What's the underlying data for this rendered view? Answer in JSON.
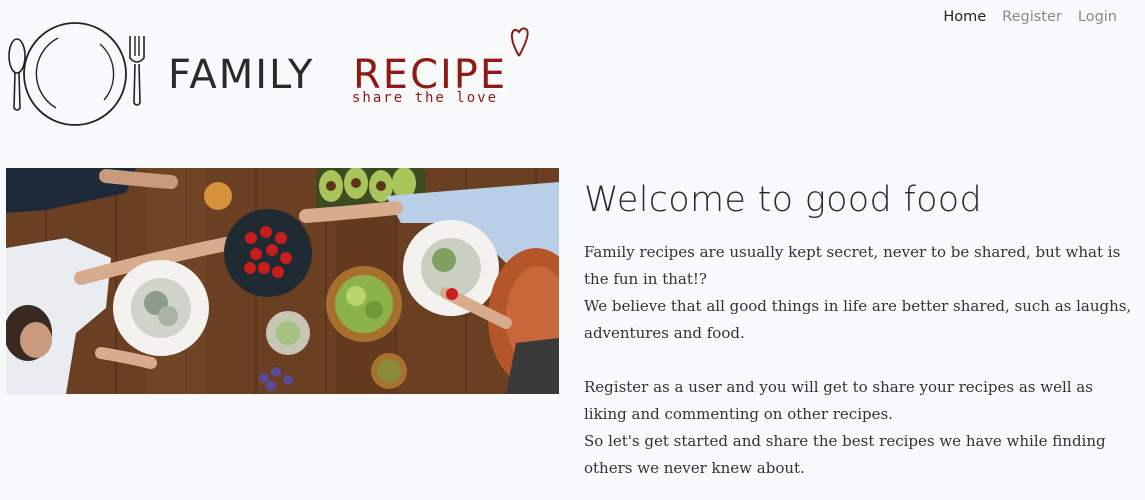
{
  "nav": {
    "home": "Home",
    "register": "Register",
    "login": "Login"
  },
  "logo": {
    "family": "FAMILY",
    "recipe": "RECIPE",
    "tagline": "share the love"
  },
  "hero": {
    "image_icon": "food-table-photo"
  },
  "welcome": {
    "title": "Welcome to good food",
    "p1": "Family recipes are usually kept secret, never to be shared, but what is the fun in that!?",
    "p2": "We believe that all good things in life are better shared, such as laughs, adventures and food.",
    "p3": "Register as a user and you will get to share your recipes as well as liking and commenting on other recipes.",
    "p4": "So let's get started and share the best recipes we have while finding others we never knew about."
  },
  "colors": {
    "background": "#f8f9fb",
    "brand_red": "#8e1a12",
    "text_dark": "#2a2a2a",
    "nav_muted": "#8a8a8a"
  }
}
